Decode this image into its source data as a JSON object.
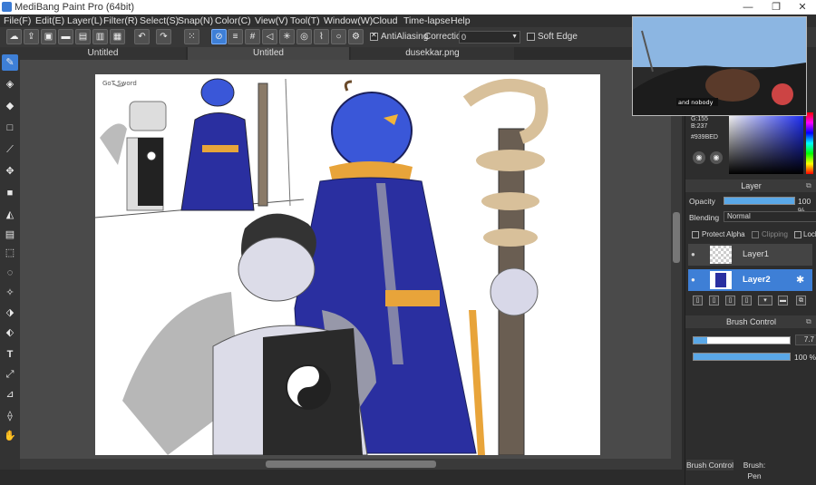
{
  "window": {
    "title": "MediBang Paint Pro (64bit)",
    "min_icon": "minimize-icon",
    "max_icon": "maximize-icon",
    "close_icon": "close-icon"
  },
  "menu": [
    {
      "label": "File(F)"
    },
    {
      "label": "Edit(E)"
    },
    {
      "label": "Layer(L)"
    },
    {
      "label": "Filter(R)"
    },
    {
      "label": "Select(S)"
    },
    {
      "label": "Snap(N)"
    },
    {
      "label": "Color(C)"
    },
    {
      "label": "View(V)"
    },
    {
      "label": "Tool(T)"
    },
    {
      "label": "Window(W)"
    },
    {
      "label": "Cloud"
    },
    {
      "label": "Time-lapse"
    },
    {
      "label": "Help"
    }
  ],
  "toolbar": {
    "antialiasing_label": "AntiAliasing",
    "antialiasing_checked": true,
    "correction_label": "Correction",
    "correction_value": "0",
    "soft_edge_label": "Soft Edge",
    "soft_edge_checked": false
  },
  "tabs": [
    {
      "label": "Untitled",
      "active": false
    },
    {
      "label": "Untitled",
      "active": true
    },
    {
      "label": "dusekkar.png",
      "active": false
    }
  ],
  "canvas": {
    "sketch_text": "GoT Sword"
  },
  "video_overlay": {
    "caption": "and nobody"
  },
  "color_panel": {
    "g_value": "G:155",
    "b_value": "B:237",
    "hex": "#939BED"
  },
  "layer_panel": {
    "title": "Layer",
    "opacity_label": "Opacity",
    "opacity_value": "100 %",
    "opacity_fraction": 1.0,
    "blending_label": "Blending",
    "blending_value": "Normal",
    "protect_alpha_label": "Protect Alpha",
    "clipping_label": "Clipping",
    "lock_label": "Lock",
    "layers": [
      {
        "name": "Layer1",
        "selected": false
      },
      {
        "name": "Layer2",
        "selected": true
      }
    ]
  },
  "brush_panel": {
    "title": "Brush Control",
    "size_value": "7.7",
    "size_fraction": 0.14,
    "opacity_value": "100 %",
    "opacity_fraction": 1.0
  },
  "bottom_tabs": [
    {
      "label": "Brush Control"
    },
    {
      "label": "Brush: Pen"
    }
  ],
  "colors": {
    "accent": "#3e7fd6",
    "panel_bg": "#2d2d2d",
    "selected_layer": "#3e7fd6"
  }
}
